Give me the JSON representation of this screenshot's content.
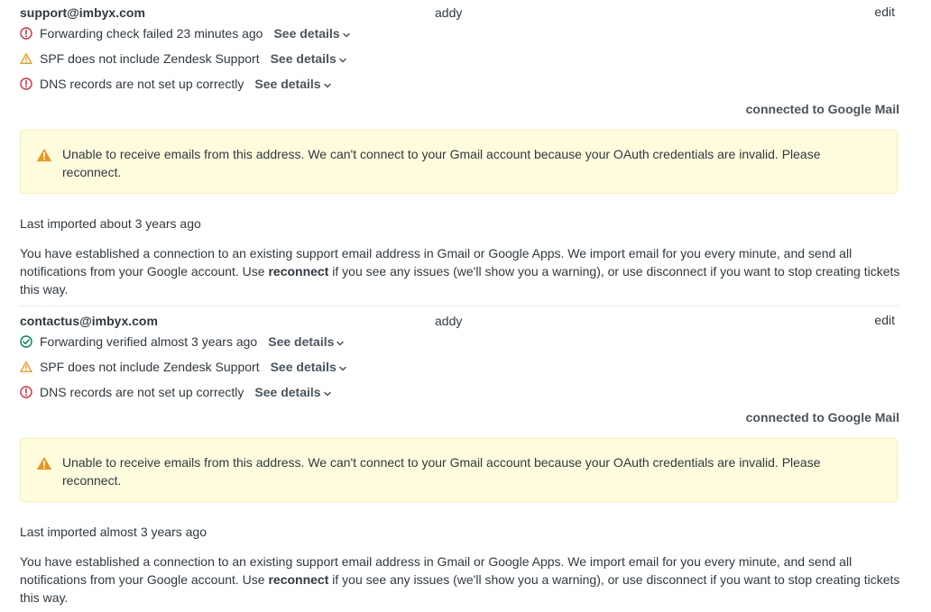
{
  "addresses": [
    {
      "email": "support@imbyx.com",
      "owner": "addy",
      "edit_label": "edit",
      "checks": [
        {
          "status": "error",
          "icon": "error-circle-icon",
          "text": "Forwarding check failed 23 minutes ago",
          "details_label": "See details"
        },
        {
          "status": "warning",
          "icon": "warning-triangle-icon",
          "text": "SPF does not include Zendesk Support",
          "details_label": "See details"
        },
        {
          "status": "error",
          "icon": "error-circle-icon",
          "text": "DNS records are not set up correctly",
          "details_label": "See details"
        }
      ],
      "connection": "connected to Google Mail",
      "alert": "Unable to receive emails from this address. We can't connect to your Gmail account because your OAuth credentials are invalid. Please reconnect.",
      "last_imported": "Last imported about 3 years ago",
      "description_before": "You have established a connection to an existing support email address in Gmail or Google Apps. We import email for you every minute, and send all notifications from your Google account. Use ",
      "description_bold": "reconnect",
      "description_after": " if you see any issues (we'll show you a warning), or use disconnect if you want to stop creating tickets this way."
    },
    {
      "email": "contactus@imbyx.com",
      "owner": "addy",
      "edit_label": "edit",
      "checks": [
        {
          "status": "success",
          "icon": "check-circle-icon",
          "text": "Forwarding verified almost 3 years ago",
          "details_label": "See details"
        },
        {
          "status": "warning",
          "icon": "warning-triangle-icon",
          "text": "SPF does not include Zendesk Support",
          "details_label": "See details"
        },
        {
          "status": "error",
          "icon": "error-circle-icon",
          "text": "DNS records are not set up correctly",
          "details_label": "See details"
        }
      ],
      "connection": "connected to Google Mail",
      "alert": "Unable to receive emails from this address. We can't connect to your Gmail account because your OAuth credentials are invalid. Please reconnect.",
      "last_imported": "Last imported almost 3 years ago",
      "description_before": "You have established a connection to an existing support email address in Gmail or Google Apps. We import email for you every minute, and send all notifications from your Google account. Use ",
      "description_bold": "reconnect",
      "description_after": " if you see any issues (we'll show you a warning), or use disconnect if you want to stop creating tickets this way."
    }
  ],
  "colors": {
    "error": "#cc3340",
    "warning": "#ed961c",
    "success": "#038153",
    "alert_background": "#fffbdd",
    "alert_border": "#faf0b0",
    "text": "#2f3941"
  }
}
